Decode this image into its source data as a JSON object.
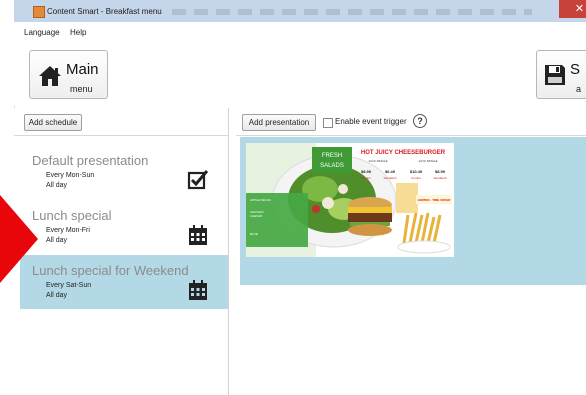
{
  "window": {
    "title": "Content Smart - Breakfast menu",
    "close": "✕"
  },
  "menu": {
    "items": [
      "Language",
      "Help"
    ]
  },
  "toolbar": {
    "main": {
      "label": "Main",
      "sub": "menu",
      "icon": "home-icon"
    },
    "save": {
      "label": "S",
      "sub": "a",
      "icon": "save-icon"
    }
  },
  "left_panel": {
    "add_schedule": "Add schedule",
    "schedules": [
      {
        "title": "Default presentation",
        "days": "Every Mon-Sun",
        "time": "All day",
        "icon": "checkbox-icon",
        "selected": false
      },
      {
        "title": "Lunch special",
        "days": "Every Mon-Fri",
        "time": "All day",
        "icon": "calendar-icon",
        "selected": false
      },
      {
        "title": "Lunch special for Weekend",
        "days": "Every Sat-Sun",
        "time": "All day",
        "icon": "calendar-icon",
        "selected": true
      }
    ]
  },
  "right_panel": {
    "add_presentation": "Add presentation",
    "enable_event_trigger": "Enable event trigger",
    "enable_event_trigger_checked": false,
    "help": "?",
    "thumbnail": {
      "fresh_salads": [
        "FRESH",
        "SALADS"
      ],
      "headline": "HOT JUICY CHEESEBURGER",
      "col_left": "1/4 lb SINGLE",
      "col_right": "1/2 lb SINGLE",
      "prices": [
        "$8.99",
        "$6.49",
        "$10.49",
        "$8.99"
      ],
      "combo": [
        "Combo",
        "Sandwich",
        "Combo",
        "Sandwich"
      ],
      "limited": "LIMITED - TIME OFFER",
      "salad_items": [
        "APPLE PECAN",
        "CHICKEN",
        "CAESAR",
        "BLUE"
      ]
    }
  },
  "colors": {
    "selected_row": "#b3d9e6",
    "presentation_bg": "#b3d9e6",
    "title_bar": "#c6d6ea",
    "close_button": "#c8413a",
    "arrow": "#e8060a"
  }
}
